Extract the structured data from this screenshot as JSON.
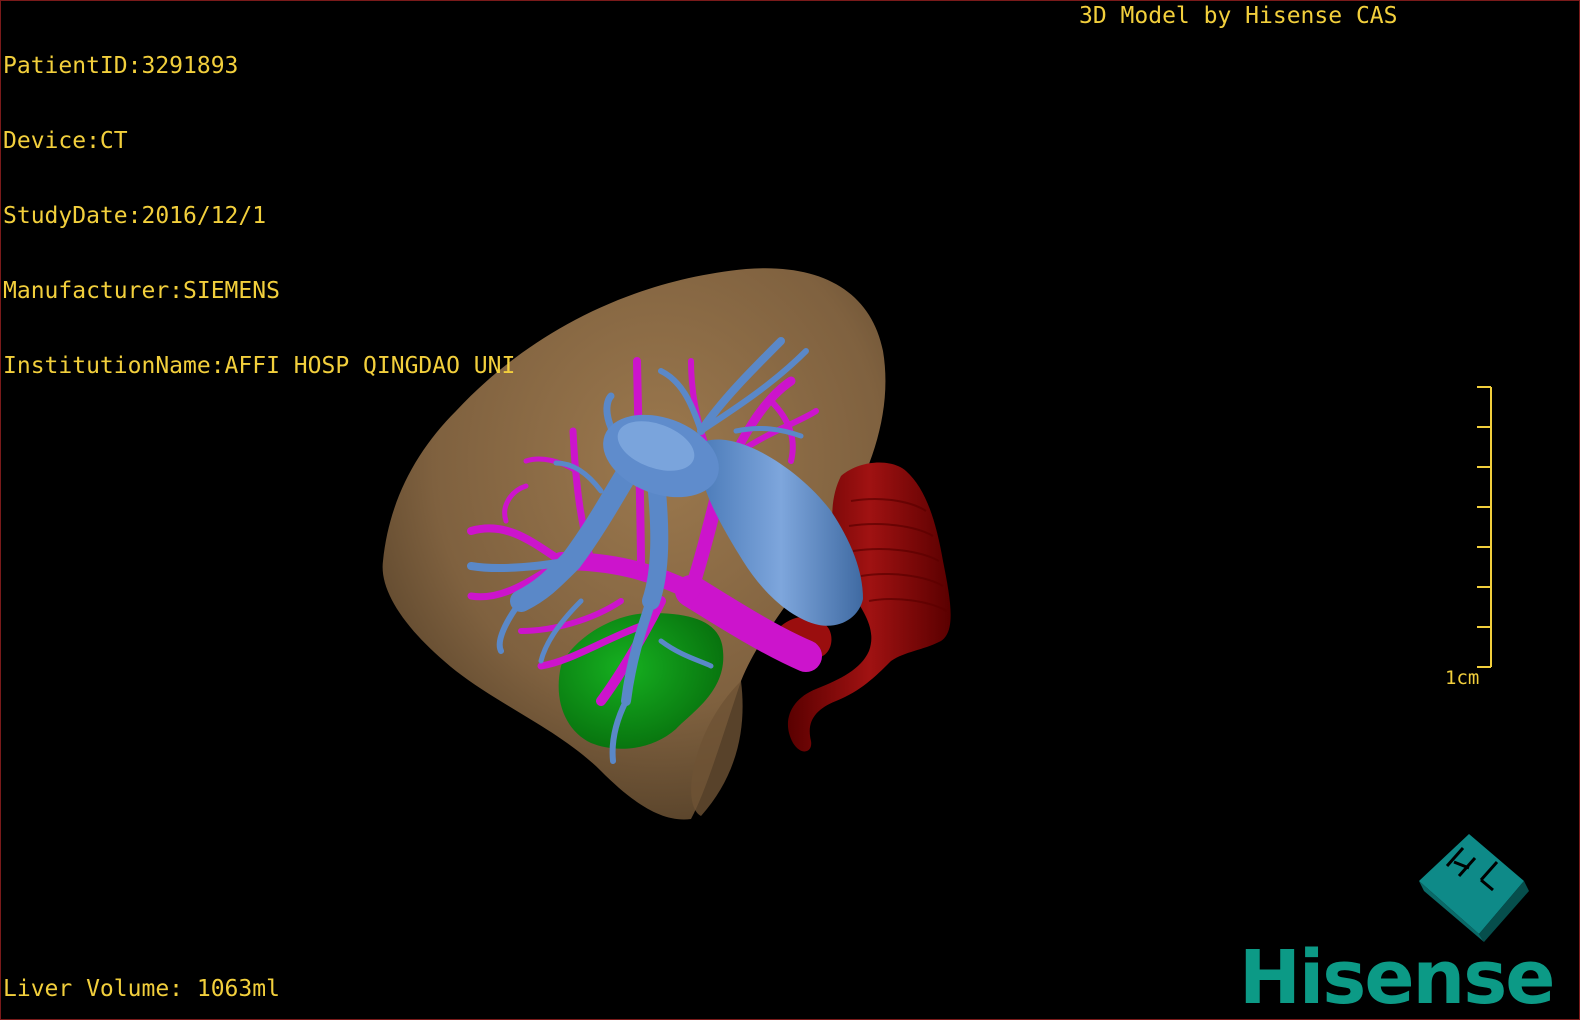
{
  "overlay": {
    "patient_id": "PatientID:3291893",
    "device": "Device:CT",
    "study_date": "StudyDate:2016/12/1",
    "manufacturer": "Manufacturer:SIEMENS",
    "institution": "InstitutionName:AFFI HOSP QINGDAO UNI",
    "credit": "3D Model by Hisense CAS",
    "liver_volume": "Liver Volume: 1063ml"
  },
  "scale_bar": {
    "label": "1cm",
    "ticks": 8
  },
  "orientation_cube": {
    "label": "HL",
    "icon": "orientation-cube-icon"
  },
  "logo": {
    "text": "Hisense"
  },
  "colors": {
    "overlay_text": "#f2cf3c",
    "liver": "#8b6a43",
    "hepatic_vein": "#5b86c6",
    "portal_vein": "#c814c8",
    "ivc_aorta": "#8a0a0a",
    "tumor_or_gallbladder": "#0d8c16",
    "brand": "#0c9a86",
    "frame_border": "#7a1a1a"
  }
}
